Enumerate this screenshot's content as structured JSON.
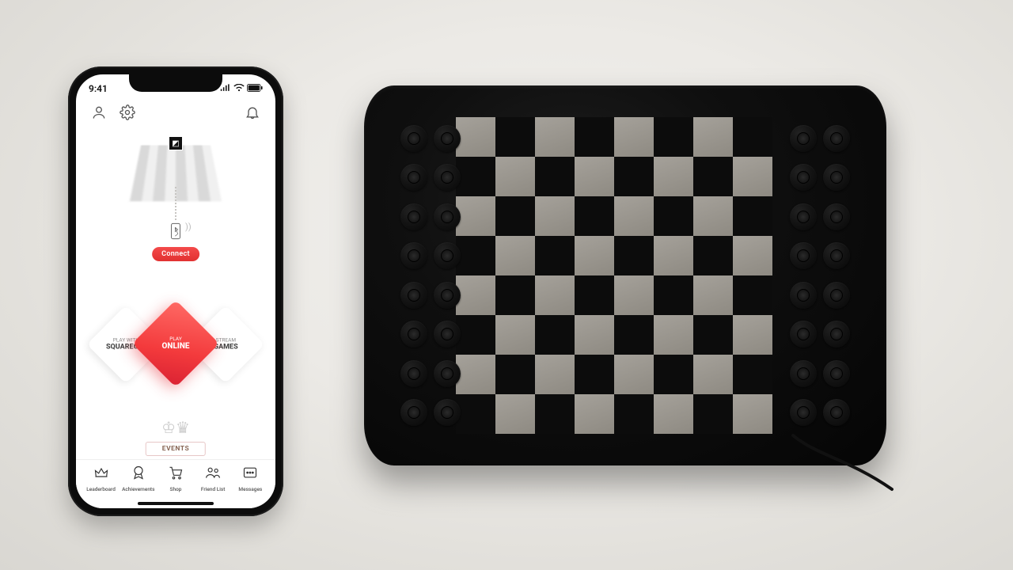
{
  "status_bar": {
    "time": "9:41"
  },
  "connect": {
    "label": "Connect"
  },
  "menu": {
    "center": {
      "line1": "PLAY",
      "line2": "ONLINE"
    },
    "left": {
      "line1": "PLAY WITH",
      "line2": "SQUAREOFF"
    },
    "right": {
      "line1": "STREAM",
      "line2": "GAMES"
    },
    "events": {
      "label": "EVENTS"
    }
  },
  "nav": {
    "items": [
      {
        "label": "Leaderboard"
      },
      {
        "label": "Achievements"
      },
      {
        "label": "Shop"
      },
      {
        "label": "Friend List"
      },
      {
        "label": "Messages"
      }
    ]
  }
}
